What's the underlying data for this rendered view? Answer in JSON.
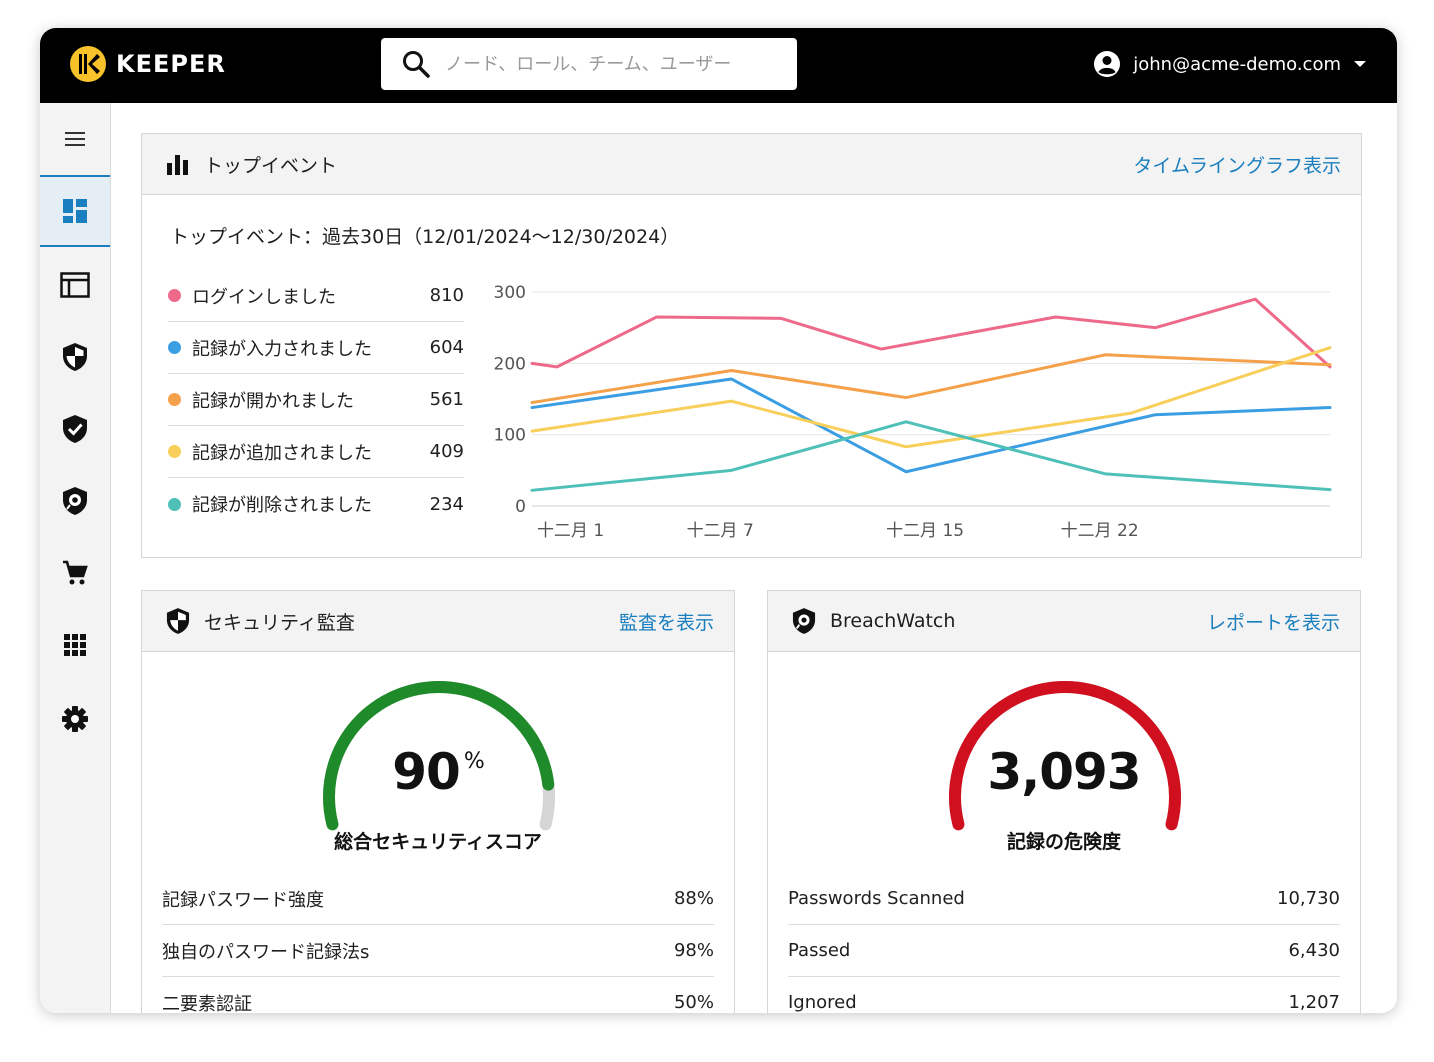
{
  "topbar": {
    "logo_text": "KEEPER",
    "search_placeholder": "ノード、ロール、チーム、ユーザー",
    "user_email": "john@acme-demo.com"
  },
  "sidebar": {
    "items": [
      {
        "icon": "menu-icon"
      },
      {
        "icon": "dashboard-icon",
        "active": true
      },
      {
        "icon": "admin-console-icon"
      },
      {
        "icon": "security-audit-icon"
      },
      {
        "icon": "compliance-shield-icon"
      },
      {
        "icon": "breachwatch-icon"
      },
      {
        "icon": "cart-icon"
      },
      {
        "icon": "apps-grid-icon"
      },
      {
        "icon": "settings-gear-icon"
      }
    ]
  },
  "top_events": {
    "title": "トップイベント",
    "link": "タイムライングラフ表示",
    "subtitle": "トップイベント：過去30日（12/01/2024～12/30/2024）",
    "legend": [
      {
        "name": "ログインしました",
        "count": "810",
        "color": "#ee6a8a"
      },
      {
        "name": "記録が入力されました",
        "count": "604",
        "color": "#3b9ee3"
      },
      {
        "name": "記録が開かれました",
        "count": "561",
        "color": "#f5a04a"
      },
      {
        "name": "記録が追加されました",
        "count": "409",
        "color": "#f7cf5a"
      },
      {
        "name": "記録が削除されました",
        "count": "234",
        "color": "#4fc0b8"
      }
    ]
  },
  "chart_data": {
    "type": "line",
    "x_tick_labels": [
      "十二月 1",
      "十二月 7",
      "十二月 15",
      "十二月 22"
    ],
    "x_tick_positions": [
      1,
      7,
      15,
      22
    ],
    "ylim": [
      0,
      300
    ],
    "y_ticks": [
      "0",
      "100",
      "200",
      "300"
    ],
    "grid": true,
    "series": [
      {
        "name": "ログインしました",
        "color": "#ee6a8a",
        "x": [
          0,
          1,
          5,
          10,
          14,
          21,
          25,
          29,
          32
        ],
        "y": [
          200,
          195,
          265,
          263,
          220,
          265,
          250,
          290,
          195
        ]
      },
      {
        "name": "記録が入力されました",
        "color": "#3b9ee3",
        "x": [
          0,
          8,
          15,
          25,
          32
        ],
        "y": [
          138,
          178,
          48,
          128,
          138
        ]
      },
      {
        "name": "記録が開かれました",
        "color": "#f5a04a",
        "x": [
          0,
          8,
          15,
          23,
          32
        ],
        "y": [
          145,
          190,
          152,
          212,
          198
        ]
      },
      {
        "name": "記録が追加されました",
        "color": "#f7cf5a",
        "x": [
          0,
          8,
          15,
          24,
          32
        ],
        "y": [
          105,
          147,
          83,
          130,
          222
        ]
      },
      {
        "name": "記録が削除されました",
        "color": "#4fc0b8",
        "x": [
          0,
          8,
          15,
          23,
          32
        ],
        "y": [
          22,
          50,
          118,
          45,
          23
        ]
      }
    ]
  },
  "security_audit": {
    "title": "セキュリティ監査",
    "link": "監査を表示",
    "score": "90",
    "score_unit": "%",
    "score_fraction": 0.9,
    "score_label": "総合セキュリティスコア",
    "gauge_color": "#1f8a2a",
    "rows": [
      {
        "label": "記録パスワード強度",
        "value": "88%"
      },
      {
        "label": "独自のパスワード記録法s",
        "value": "98%"
      },
      {
        "label": "二要素認証",
        "value": "50%"
      }
    ]
  },
  "breachwatch": {
    "title": "BreachWatch",
    "link": "レポートを表示",
    "value": "3,093",
    "value_label": "記録の危険度",
    "gauge_fraction": 1.0,
    "gauge_color": "#d0101f",
    "rows": [
      {
        "label": "Passwords Scanned",
        "value": "10,730"
      },
      {
        "label": "Passed",
        "value": "6,430"
      },
      {
        "label": "Ignored",
        "value": "1,207"
      }
    ]
  }
}
